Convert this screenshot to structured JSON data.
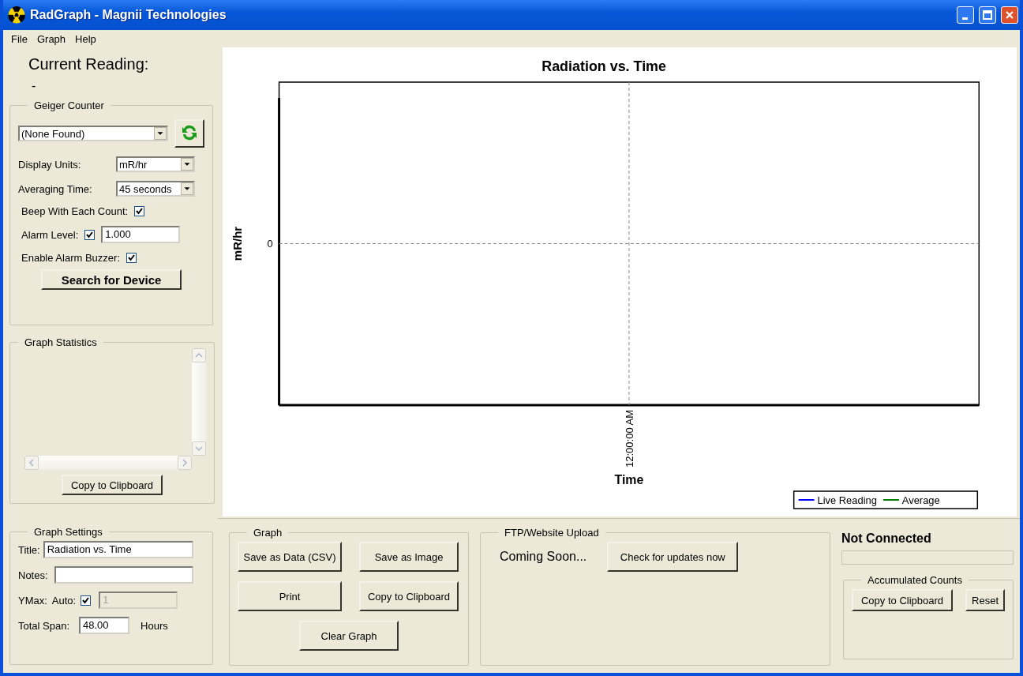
{
  "window": {
    "title": "RadGraph - Magnii Technologies"
  },
  "menu": [
    "File",
    "Graph",
    "Help"
  ],
  "current_reading": {
    "label": "Current Reading:",
    "value": "-"
  },
  "geiger_counter": {
    "title": "Geiger Counter",
    "device": "(None Found)",
    "fields": [
      {
        "kind": "select",
        "label": "Display Units:",
        "value": "mR/hr"
      },
      {
        "kind": "select",
        "label": "Averaging Time:",
        "value": "45 seconds"
      },
      {
        "kind": "checkbox",
        "label": "Beep With Each Count:",
        "checked": true
      },
      {
        "kind": "checkbox_input",
        "label": "Alarm Level:",
        "checked": true,
        "value": "1.000"
      },
      {
        "kind": "checkbox",
        "label": "Enable Alarm Buzzer:",
        "checked": true
      }
    ],
    "button": "Search for Device"
  },
  "graph_statistics": {
    "title": "Graph Statistics",
    "button": "Copy to Clipboard"
  },
  "chart": {
    "title": "Radiation vs. Time",
    "xlabel": "Time",
    "ylabel": "mR/hr",
    "x_tick": "12:00:00 AM",
    "y_tick": "0",
    "legend": [
      {
        "name": "Live Reading",
        "color": "#0000ff"
      },
      {
        "name": "Average",
        "color": "#008000"
      }
    ]
  },
  "graph_settings": {
    "title": "Graph Settings",
    "title_label": "Title:",
    "title_value": "Radiation vs. Time",
    "notes_label": "Notes:",
    "ymax_label": "YMax:",
    "auto_label": "Auto:",
    "auto_checked": true,
    "ymax_value": "1",
    "ymax_disabled": true,
    "span_label": "Total Span:",
    "span_value": "48.00",
    "span_unit": "Hours"
  },
  "graph_actions": {
    "title": "Graph",
    "buttons": [
      "Save as Data (CSV)",
      "Save as Image",
      "Print",
      "Copy to Clipboard",
      "Clear Graph"
    ]
  },
  "ftp_upload": {
    "title": "FTP/Website Upload",
    "message": "Coming Soon...",
    "button": "Check for updates now"
  },
  "connection": {
    "status": "Not Connected",
    "level": 0,
    "accumulated_counts": {
      "title": "Accumulated Counts",
      "buttons": [
        "Copy to Clipboard",
        "Reset"
      ]
    }
  }
}
